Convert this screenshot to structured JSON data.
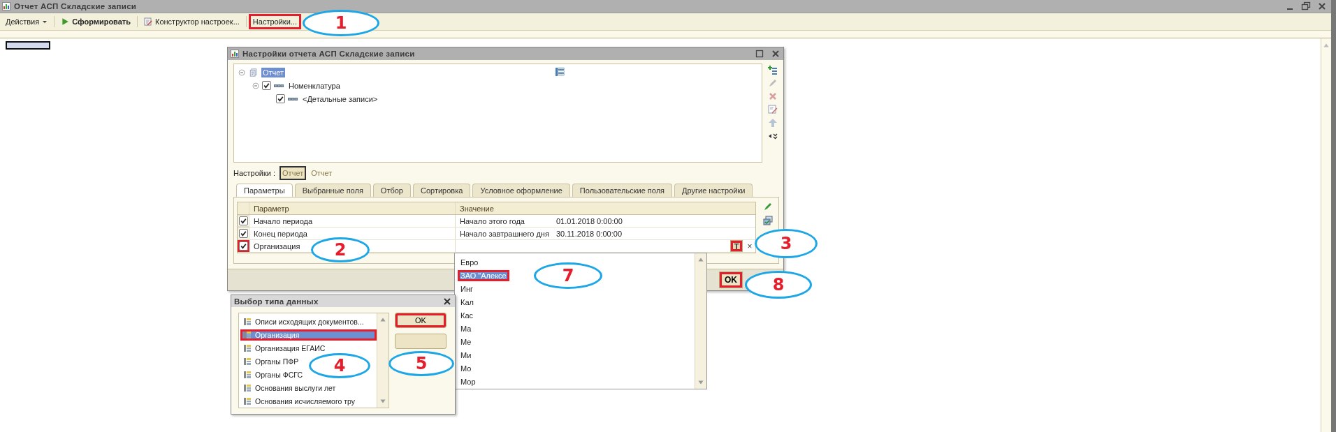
{
  "main_window": {
    "title": "Отчет  АСП Складские записи",
    "toolbar": [
      {
        "label": "Действия",
        "kind": "menu",
        "highlighted": false
      },
      {
        "label": "Сформировать",
        "kind": "run",
        "highlighted": false
      },
      {
        "label": "Конструктор настроек...",
        "kind": "wizard",
        "highlighted": false
      },
      {
        "label": "Настройки...",
        "kind": "plain",
        "highlighted": true
      }
    ]
  },
  "settings_dialog": {
    "title": "Настройки отчета  АСП Складские записи",
    "tree": [
      {
        "label": "Отчет",
        "kind": "report",
        "selected": true,
        "expanded": true,
        "children": [
          {
            "label": "Номенклатура",
            "kind": "group",
            "selected": false,
            "checked": true,
            "expanded": true,
            "children": [
              {
                "label": "<Детальные записи>",
                "kind": "group",
                "selected": false,
                "checked": true
              }
            ]
          }
        ]
      }
    ],
    "settings_label": "Настройки :",
    "variants": [
      {
        "label": "Отчет",
        "selected": true
      },
      {
        "label": "Отчет",
        "selected": false
      }
    ],
    "tabs": [
      {
        "label": "Параметры",
        "selected": true
      },
      {
        "label": "Выбранные поля",
        "selected": false
      },
      {
        "label": "Отбор",
        "selected": false
      },
      {
        "label": "Сортировка",
        "selected": false
      },
      {
        "label": "Условное оформление",
        "selected": false
      },
      {
        "label": "Пользовательские поля",
        "selected": false
      },
      {
        "label": "Другие настройки",
        "selected": false
      }
    ],
    "columns": [
      "Параметр",
      "Значение"
    ],
    "rows": [
      {
        "kind": "value",
        "checked": true,
        "highlighted": false,
        "name": "Начало периода",
        "value": "Начало этого года",
        "date": "01.01.2018 0:00:00"
      },
      {
        "kind": "value",
        "checked": true,
        "highlighted": false,
        "name": "Конец периода",
        "value": "Начало завтрашнего дня",
        "date": "30.11.2018 0:00:00"
      },
      {
        "kind": "input",
        "checked": true,
        "highlighted": true,
        "name": "Организация",
        "type_button": {
          "label": "T",
          "highlighted": true
        },
        "clear_button": "×"
      }
    ],
    "ok_button": {
      "label": "OK",
      "highlighted": true
    }
  },
  "value_dropdown": {
    "items": [
      {
        "label": "Евро",
        "selected": false,
        "highlighted": false
      },
      {
        "label": "ЗАО \"Алексе",
        "selected": true,
        "highlighted": true
      },
      {
        "label": "Инг",
        "selected": false,
        "highlighted": false
      },
      {
        "label": "Кал",
        "selected": false,
        "highlighted": false
      },
      {
        "label": "Кас",
        "selected": false,
        "highlighted": false
      },
      {
        "label": "Ма",
        "selected": false,
        "highlighted": false
      },
      {
        "label": "Ме",
        "selected": false,
        "highlighted": false
      },
      {
        "label": "Ми",
        "selected": false,
        "highlighted": false
      },
      {
        "label": "Мо",
        "selected": false,
        "highlighted": false
      },
      {
        "label": "Мор",
        "selected": false,
        "highlighted": false
      }
    ]
  },
  "type_dialog": {
    "title": "Выбор типа данных",
    "items": [
      {
        "label": "Описи исходящих документов...",
        "selected": false,
        "highlighted": false
      },
      {
        "label": "Организация",
        "selected": true,
        "highlighted": true
      },
      {
        "label": "Организация ЕГАИС",
        "selected": false,
        "highlighted": false
      },
      {
        "label": "Органы ПФР",
        "selected": false,
        "highlighted": false
      },
      {
        "label": "Органы ФСГС",
        "selected": false,
        "highlighted": false
      },
      {
        "label": "Основания выслуги лет",
        "selected": false,
        "highlighted": false
      },
      {
        "label": "Основания исчисляемого тру",
        "selected": false,
        "highlighted": false
      }
    ],
    "ok_button": {
      "label": "OK",
      "highlighted": true
    }
  },
  "callouts": [
    {
      "number": "1"
    },
    {
      "number": "2"
    },
    {
      "number": "3"
    },
    {
      "number": "4"
    },
    {
      "number": "5"
    },
    {
      "number": "7"
    },
    {
      "number": "8"
    }
  ]
}
